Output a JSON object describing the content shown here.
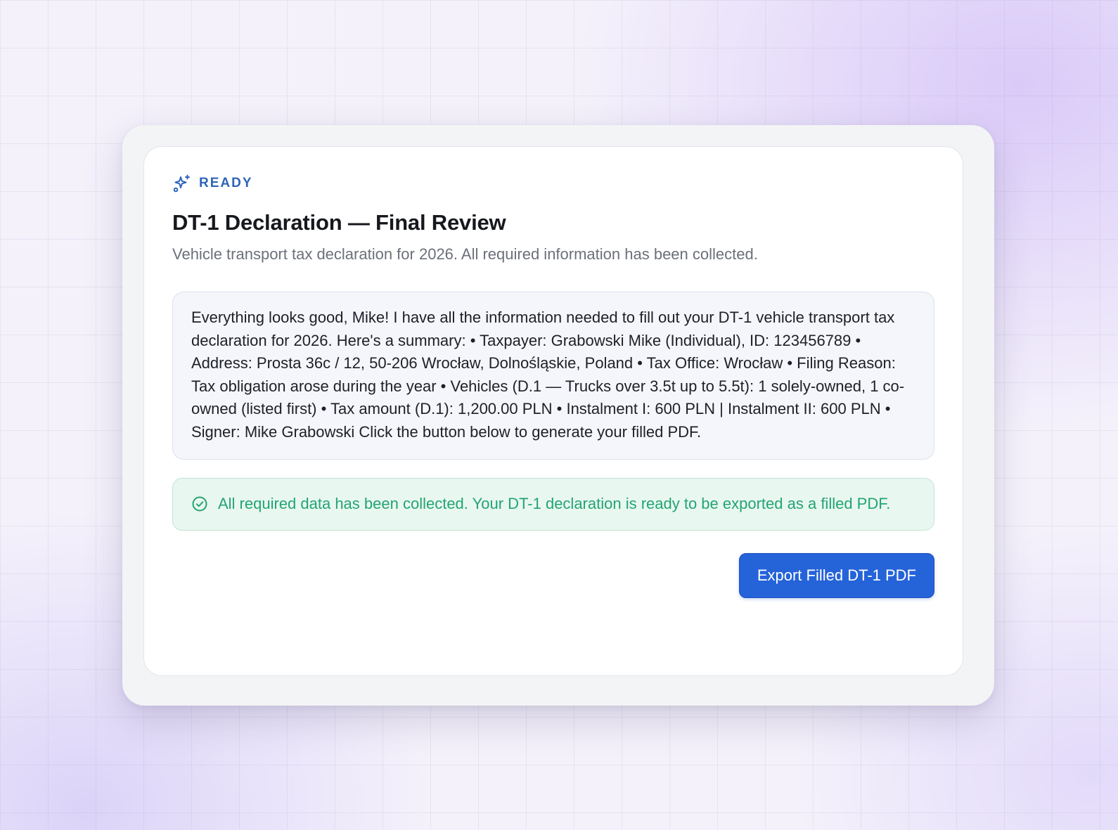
{
  "status": {
    "label": "READY",
    "icon": "sparkles-icon",
    "color": "#2f65b8"
  },
  "title": "DT-1 Declaration — Final Review",
  "subtitle": "Vehicle transport tax declaration for 2026. All required information has been collected.",
  "summary_text": "Everything looks good, Mike! I have all the information needed to fill out your DT-1 vehicle transport tax declaration for 2026. Here's a summary: • Taxpayer: Grabowski Mike (Individual), ID: 123456789 • Address: Prosta 36c / 12, 50-206 Wrocław, Dolnośląskie, Poland • Tax Office: Wrocław • Filing Reason: Tax obligation arose during the year • Vehicles (D.1 — Trucks over 3.5t up to 5.5t): 1 solely-owned, 1 co-owned (listed first) • Tax amount (D.1): 1,200.00 PLN • Instalment I: 600 PLN | Instalment II: 600 PLN • Signer: Mike Grabowski Click the button below to generate your filled PDF.",
  "success_message": {
    "text": "All required data has been collected. Your DT-1 declaration is ready to be exported as a filled PDF.",
    "icon": "check-circle-icon",
    "color": "#23a472"
  },
  "actions": {
    "export_label": "Export Filled DT-1 PDF",
    "accent": "#2563d9"
  }
}
